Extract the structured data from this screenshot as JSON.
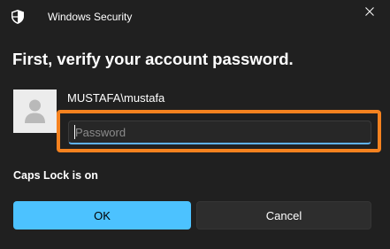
{
  "window": {
    "title": "Windows Security",
    "close_icon": "close-icon",
    "app_icon": "shield-icon"
  },
  "main": {
    "heading": "First, verify your account password.",
    "account": {
      "username": "MUSTAFA\\mustafa",
      "avatar_icon": "user-avatar-icon"
    },
    "password": {
      "value": "",
      "placeholder": "Password"
    },
    "caps_lock_warning": "Caps Lock is on"
  },
  "buttons": {
    "ok_label": "OK",
    "cancel_label": "Cancel"
  },
  "colors": {
    "background": "#202020",
    "accent": "#4cc2ff",
    "highlight": "#f5821f",
    "focus_underline": "#5fb2f2"
  }
}
